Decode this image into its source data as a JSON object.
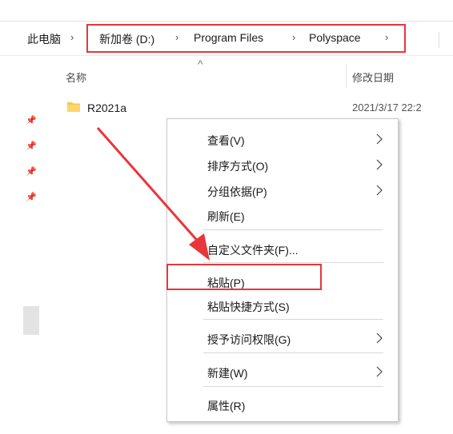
{
  "breadcrumb": {
    "root": "此电脑",
    "items": [
      "新加卷 (D:)",
      "Program Files",
      "Polyspace"
    ],
    "separator": "›"
  },
  "columns": {
    "name": "名称",
    "date": "修改日期",
    "sort_indicator": "^"
  },
  "files": [
    {
      "name": "R2021a",
      "date": "2021/3/17 22:2",
      "icon": "folder-icon"
    }
  ],
  "context_menu": [
    {
      "label": "查看(V)",
      "submenu": true
    },
    {
      "label": "排序方式(O)",
      "submenu": true
    },
    {
      "label": "分组依据(P)",
      "submenu": true
    },
    {
      "label": "刷新(E)",
      "submenu": false
    },
    {
      "label": "自定义文件夹(F)...",
      "submenu": false
    },
    {
      "label": "粘贴(P)",
      "submenu": false
    },
    {
      "label": "粘贴快捷方式(S)",
      "submenu": false
    },
    {
      "label": "授予访问权限(G)",
      "submenu": true
    },
    {
      "label": "新建(W)",
      "submenu": true
    },
    {
      "label": "属性(R)",
      "submenu": false
    }
  ],
  "colors": {
    "highlight": "#e8363a",
    "folder": "#f8c74a"
  }
}
